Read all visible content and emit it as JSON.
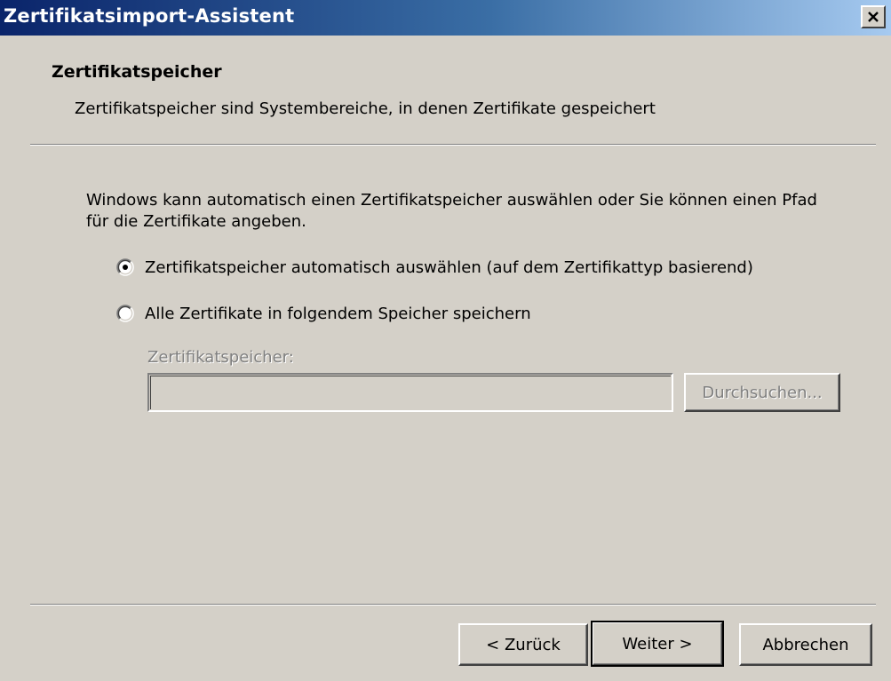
{
  "window": {
    "title": "Zertifikatsimport-Assistent"
  },
  "header": {
    "title": "Zertifikatspeicher",
    "subtitle": "Zertifikatspeicher sind Systembereiche, in denen Zertifikate gespeichert"
  },
  "body": {
    "description": "Windows kann automatisch einen Zertifikatspeicher auswählen oder Sie können einen Pfad für die Zertifikate angeben.",
    "options": [
      {
        "label": "Zertifikatspeicher automatisch auswählen (auf dem Zertifikattyp basierend)",
        "selected": true
      },
      {
        "label": "Alle Zertifikate in folgendem Speicher speichern",
        "selected": false
      }
    ],
    "store_label": "Zertifikatspeicher:",
    "store_value": "",
    "browse_label": "Durchsuchen..."
  },
  "footer": {
    "back_label": "< Zurück",
    "next_label": "Weiter >",
    "cancel_label": "Abbrechen"
  },
  "icons": {
    "close": "close-icon"
  },
  "colors": {
    "title_gradient_start": "#0a246a",
    "title_gradient_end": "#a6caf0",
    "window_bg": "#d4d0c8",
    "disabled_text": "#808080"
  }
}
